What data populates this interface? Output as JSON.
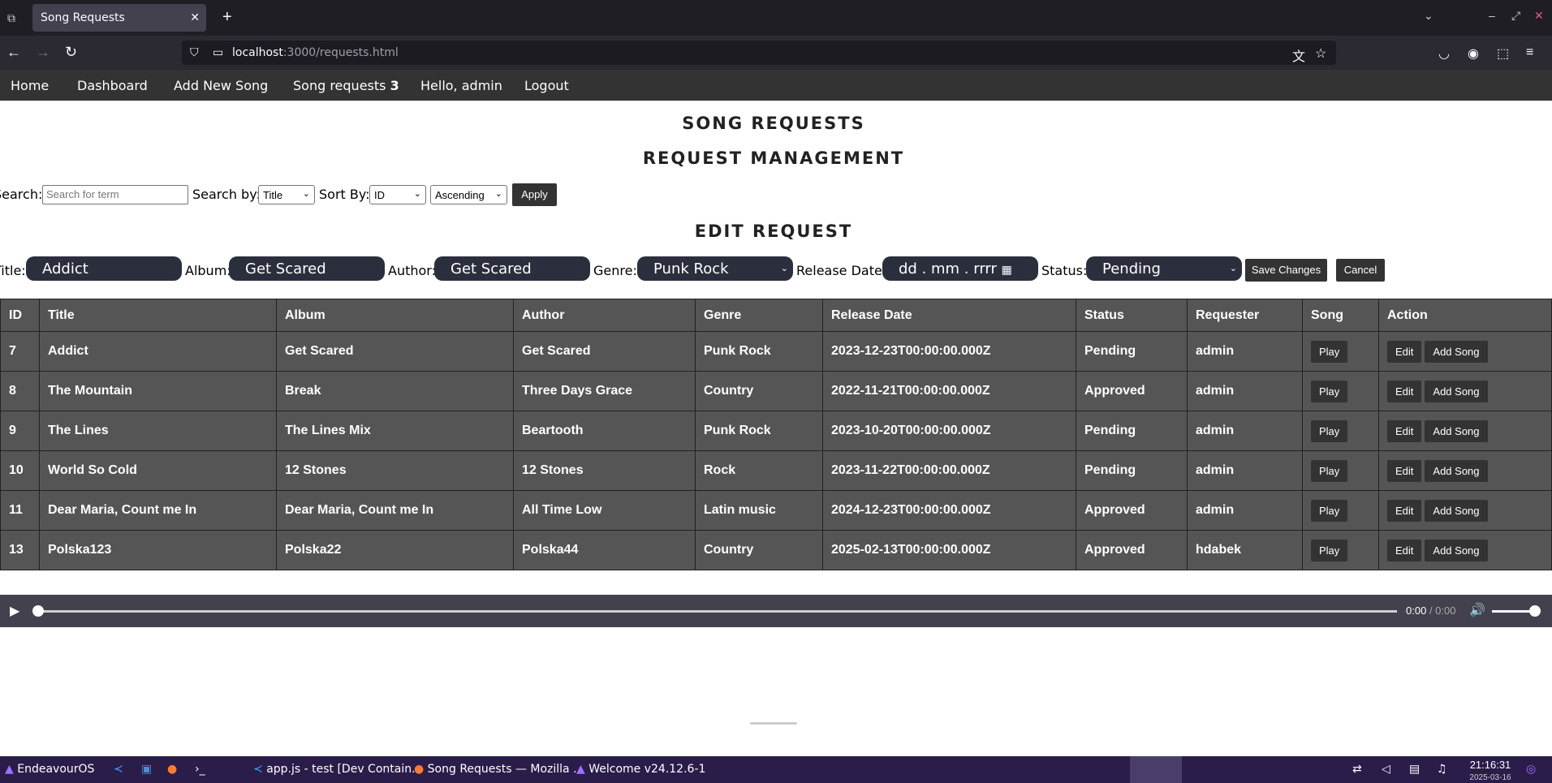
{
  "browser": {
    "tab_title": "Song Requests",
    "url_host": "localhost",
    "url_path": ":3000/requests.html"
  },
  "site_nav": {
    "home": "Home",
    "dashboard": "Dashboard",
    "add_new_song": "Add New Song",
    "song_requests": "Song requests",
    "song_requests_count": "3",
    "hello": "Hello, admin",
    "logout": "Logout"
  },
  "headings": {
    "title": "SONG REQUESTS",
    "subtitle": "REQUEST MANAGEMENT",
    "edit": "EDIT REQUEST"
  },
  "search": {
    "label": "Search:",
    "placeholder": "Search for term",
    "search_by_label": "Search by:",
    "search_by_value": "Title",
    "sort_by_label": "Sort By:",
    "sort_by_value": "ID",
    "order_value": "Ascending",
    "apply": "Apply"
  },
  "edit_form": {
    "title_label": "Title:",
    "title_value": "Addict",
    "album_label": "Album:",
    "album_value": "Get Scared",
    "author_label": "Author:",
    "author_value": "Get Scared",
    "genre_label": "Genre:",
    "genre_value": "Punk Rock",
    "release_label": "Release Date:",
    "release_value": "dd . mm . rrrr",
    "status_label": "Status:",
    "status_value": "Pending",
    "save": "Save Changes",
    "cancel": "Cancel"
  },
  "table": {
    "headers": [
      "ID",
      "Title",
      "Album",
      "Author",
      "Genre",
      "Release Date",
      "Status",
      "Requester",
      "Song",
      "Action"
    ],
    "rows": [
      {
        "id": "7",
        "title": "Addict",
        "album": "Get Scared",
        "author": "Get Scared",
        "genre": "Punk Rock",
        "date": "2023-12-23T00:00:00.000Z",
        "status": "Pending",
        "requester": "admin"
      },
      {
        "id": "8",
        "title": "The Mountain",
        "album": "Break",
        "author": "Three Days Grace",
        "genre": "Country",
        "date": "2022-11-21T00:00:00.000Z",
        "status": "Approved",
        "requester": "admin"
      },
      {
        "id": "9",
        "title": "The Lines",
        "album": "The Lines Mix",
        "author": "Beartooth",
        "genre": "Punk Rock",
        "date": "2023-10-20T00:00:00.000Z",
        "status": "Pending",
        "requester": "admin"
      },
      {
        "id": "10",
        "title": "World So Cold",
        "album": "12 Stones",
        "author": "12 Stones",
        "genre": "Rock",
        "date": "2023-11-22T00:00:00.000Z",
        "status": "Pending",
        "requester": "admin"
      },
      {
        "id": "11",
        "title": "Dear Maria, Count me In",
        "album": "Dear Maria, Count me In",
        "author": "All Time Low",
        "genre": "Latin music",
        "date": "2024-12-23T00:00:00.000Z",
        "status": "Approved",
        "requester": "admin"
      },
      {
        "id": "13",
        "title": "Polska123",
        "album": "Polska22",
        "author": "Polska44",
        "genre": "Country",
        "date": "2025-02-13T00:00:00.000Z",
        "status": "Approved",
        "requester": "hdabek"
      }
    ],
    "play_label": "Play",
    "edit_label": "Edit",
    "add_song_label": "Add Song"
  },
  "audio": {
    "current": "0:00",
    "total": "/ 0:00",
    "progress": 0
  },
  "taskbar": {
    "start": "EndeavourOS",
    "vscode_task": "app.js - test [Dev Contain...",
    "firefox_task": "Song Requests — Mozilla ...",
    "welcome_task": "Welcome v24.12.6-1",
    "time": "21:16:31",
    "date": "2025-03-16"
  }
}
